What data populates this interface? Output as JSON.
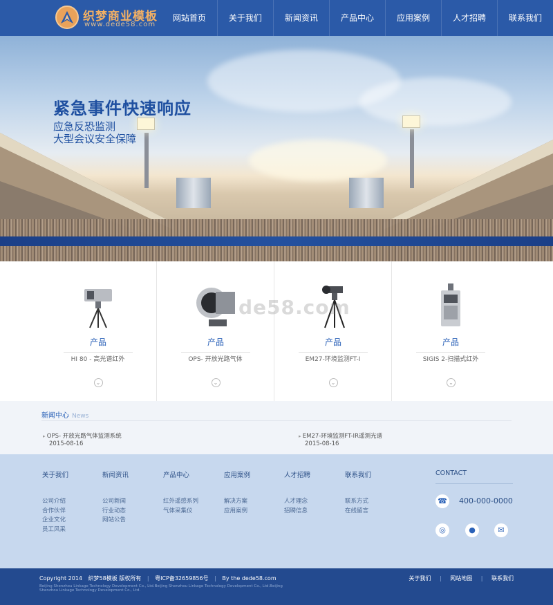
{
  "header": {
    "logo_title": "织梦商业模板",
    "logo_url": "www.dede58.com",
    "nav": [
      "网站首页",
      "关于我们",
      "新闻资讯",
      "产品中心",
      "应用案例",
      "人才招聘",
      "联系我们"
    ]
  },
  "banner": {
    "title": "紧急事件快速响应",
    "subtitle_1": "应急反恐监测",
    "subtitle_2": "大型会议安全保障"
  },
  "products": {
    "watermark": "de58.com",
    "items": [
      {
        "category": "产品",
        "name": "HI 80 - 高光谱红外"
      },
      {
        "category": "产品",
        "name": "OPS- 开放光路气体"
      },
      {
        "category": "产品",
        "name": "EM27-环境监测FT-I"
      },
      {
        "category": "产品",
        "name": "SIGIS 2-扫描式红外"
      }
    ]
  },
  "news": {
    "title": "新闻中心",
    "title_en": "News",
    "items": [
      {
        "title": "OPS- 开放光路气体监测系统",
        "date": "2015-08-16"
      },
      {
        "title": "EM27-环境监测FT-IR遥测光谱",
        "date": "2015-08-16"
      }
    ]
  },
  "footer": {
    "columns": [
      {
        "title": "关于我们",
        "links": [
          "公司介绍",
          "合作伙伴",
          "企业文化",
          "员工风采"
        ]
      },
      {
        "title": "新闻资讯",
        "links": [
          "公司新闻",
          "行业动态",
          "网站公告"
        ]
      },
      {
        "title": "产品中心",
        "links": [
          "红外遥感系列",
          "气体采集仪"
        ]
      },
      {
        "title": "应用案例",
        "links": [
          "解决方案",
          "应用案例"
        ]
      },
      {
        "title": "人才招聘",
        "links": [
          "人才理念",
          "招聘信息"
        ]
      },
      {
        "title": "联系我们",
        "links": [
          "联系方式",
          "在线留言"
        ]
      }
    ],
    "contact_title": "CONTACT",
    "phone": "400-000-0000"
  },
  "bottom": {
    "copyright": "Copyright 2014",
    "company": "织梦58模板 版权所有",
    "icp": "粤ICP备32659856号",
    "by": "By the dede58.com",
    "small_1": "Beijing Shenzhou Linkage Technology Development Co., Ltd.Beijing Shenzhou Linkage Technology Development Co., Ltd.Beijing",
    "small_2": "Shenzhou Linkage Technology Development Co., Ltd.",
    "links": [
      "关于我们",
      "网站地图",
      "联系我们"
    ]
  },
  "colors": {
    "header_bg": "#2b5aa8",
    "accent": "#2b62b8",
    "footer_bg": "#c7d8ee",
    "bottom_bg": "#234a8f",
    "logo_orange": "#f2b064"
  }
}
